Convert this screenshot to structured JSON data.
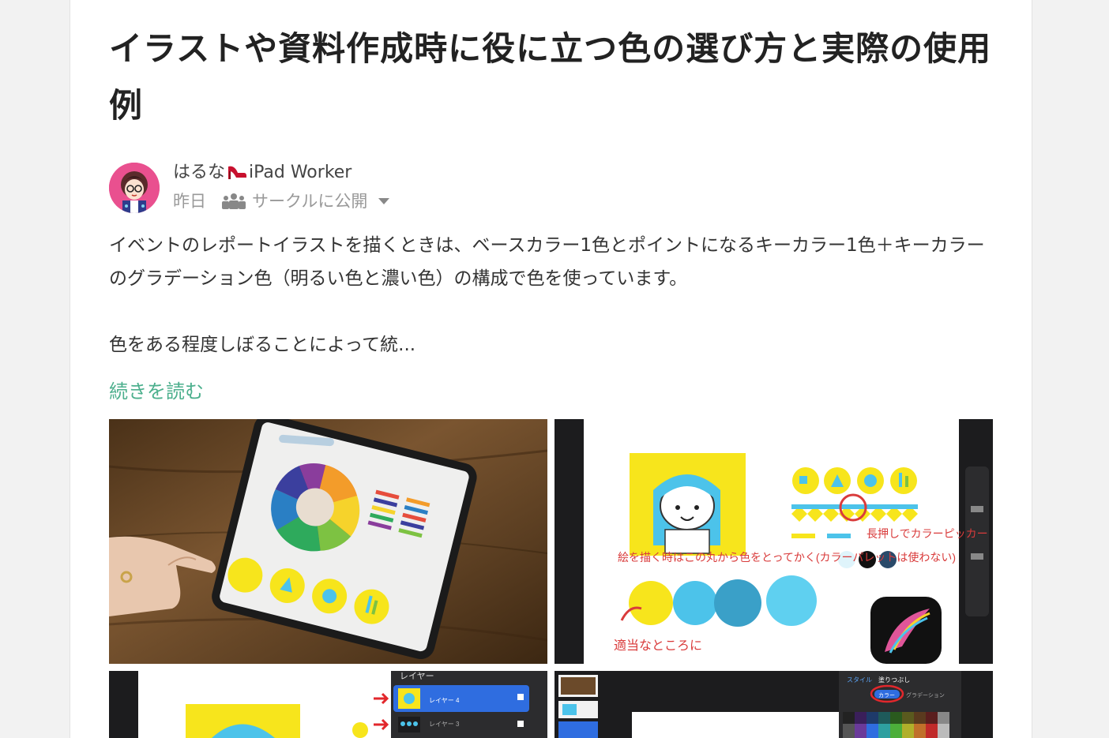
{
  "post": {
    "title": "イラストや資料作成時に役に立つ色の選び方と実際の使用例",
    "author": {
      "name_prefix": "はるな",
      "name_suffix": "iPad Worker",
      "emoji_icon": "high-heel-icon"
    },
    "date": "昨日",
    "visibility": "サークルに公開",
    "body": [
      "イベントのレポートイラストを描くときは、ベースカラー1色とポイントになるキーカラー1色＋キーカラーのグラデーション色（明るい色と濃い色）の構成で色を使っています。",
      "色をある程度しぼることによって統..."
    ],
    "read_more": "続きを読む"
  },
  "images": {
    "img2": {
      "caption_left": "絵を描く時はこの丸から色をとってかく(カラーパレットは使わない)",
      "caption_right": "長押しでカラーピッカー",
      "caption_bottom": "適当なところに"
    },
    "img3": {
      "layers_title": "レイヤー",
      "layer_a": "レイヤー 4",
      "layer_b": "レイヤー 3"
    },
    "img4": {
      "tab_style": "スタイル",
      "tab_fill": "塗りつぶし",
      "tab_color": "カラー",
      "tab_gradient": "グラデーション"
    }
  },
  "colors": {
    "accent": "#4caf8d",
    "yellow": "#f7e51c",
    "blue_light": "#4cc3ea",
    "blue_mid": "#3aa0c8",
    "blue_pale": "#5fd0f0",
    "wood": "#6b4a2a"
  }
}
